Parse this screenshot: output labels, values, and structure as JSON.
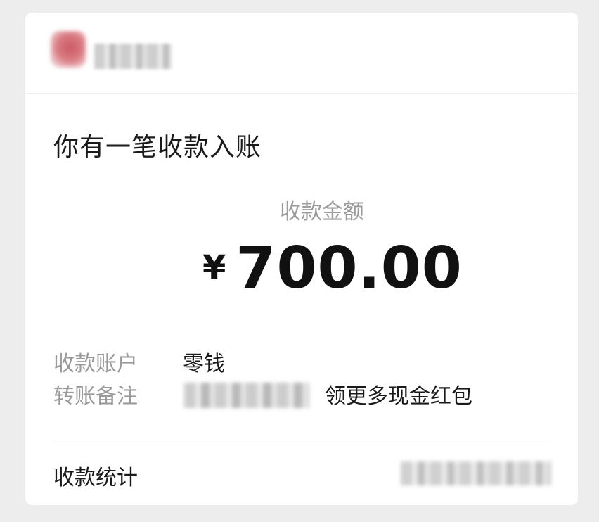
{
  "notification": {
    "title": "你有一笔收款入账",
    "amount_label": "收款金额",
    "currency_symbol": "¥",
    "amount": "700.00",
    "details": [
      {
        "label": "收款账户",
        "value": "零钱"
      },
      {
        "label": "转账备注",
        "value": "领更多现金红包"
      }
    ],
    "stats_label": "收款统计"
  },
  "colors": {
    "background": "#ededed",
    "card": "#ffffff",
    "primary_text": "#1a1a1a",
    "secondary_text": "#9a9a9a"
  }
}
